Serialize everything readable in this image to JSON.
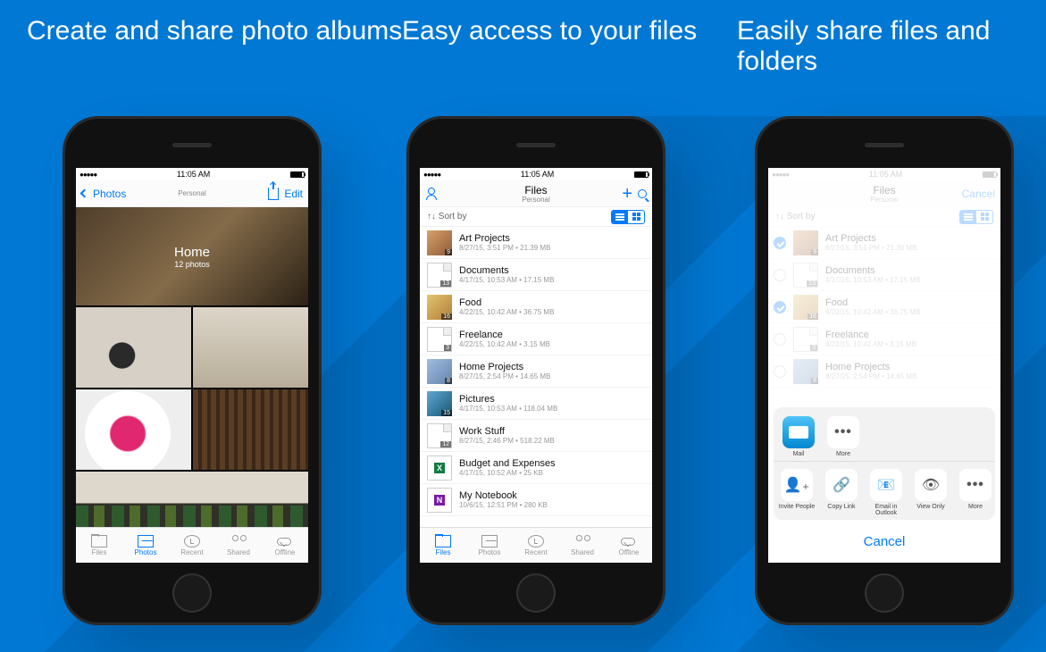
{
  "captions": {
    "c1": "Create and share photo albums",
    "c2": "Easy access to your files",
    "c3": "Easily share files and folders"
  },
  "status": {
    "time": "11:05 AM",
    "carrier_dots": "●●●●●",
    "wifi": "􀙇"
  },
  "screen1": {
    "back": "Photos",
    "title_sub": "Personal",
    "edit": "Edit",
    "album_title": "Home",
    "album_count": "12 photos"
  },
  "screen2": {
    "title": "Files",
    "title_sub": "Personal",
    "sort_label": "Sort by"
  },
  "screen3": {
    "title": "Files",
    "title_sub": "Personal",
    "cancel": "Cancel",
    "sort_label": "Sort by"
  },
  "files": [
    {
      "name": "Art Projects",
      "meta": "8/27/15, 3:51 PM • 21.39 MB",
      "badge": "9",
      "kind": "art",
      "selected": true
    },
    {
      "name": "Documents",
      "meta": "4/17/15, 10:53 AM • 17.15 MB",
      "badge": "13",
      "kind": "doc",
      "selected": false
    },
    {
      "name": "Food",
      "meta": "4/22/15, 10:42 AM • 36.75 MB",
      "badge": "16",
      "kind": "food",
      "selected": true
    },
    {
      "name": "Freelance",
      "meta": "4/22/15, 10:42 AM • 3.15 MB",
      "badge": "3",
      "kind": "doc",
      "selected": false
    },
    {
      "name": "Home Projects",
      "meta": "8/27/15, 2:54 PM • 14.65 MB",
      "badge": "8",
      "kind": "hp",
      "selected": false
    },
    {
      "name": "Pictures",
      "meta": "4/17/15, 10:53 AM • 118.04 MB",
      "badge": "15",
      "kind": "pic",
      "selected": false
    },
    {
      "name": "Work Stuff",
      "meta": "8/27/15, 2:46 PM • 518.22 MB",
      "badge": "12",
      "kind": "doc",
      "selected": false
    },
    {
      "name": "Budget and Expenses",
      "meta": "4/17/15, 10:52 AM • 25 KB",
      "badge": "",
      "kind": "excel",
      "selected": false
    },
    {
      "name": "My Notebook",
      "meta": "10/6/15, 12:51 PM • 280 KB",
      "badge": "",
      "kind": "onenote",
      "selected": false
    }
  ],
  "tabs": [
    {
      "id": "files",
      "label": "Files"
    },
    {
      "id": "photos",
      "label": "Photos"
    },
    {
      "id": "recent",
      "label": "Recent"
    },
    {
      "id": "shared",
      "label": "Shared"
    },
    {
      "id": "offline",
      "label": "Offline"
    }
  ],
  "share_sheet": {
    "row1": [
      {
        "label": "Mail",
        "icon": "mail"
      },
      {
        "label": "More",
        "icon": "more"
      }
    ],
    "row2": [
      {
        "label": "Invite People",
        "icon": "person-plus"
      },
      {
        "label": "Copy Link",
        "icon": "link"
      },
      {
        "label": "Email in Outlook",
        "icon": "outlook"
      },
      {
        "label": "View Only",
        "icon": "eye"
      },
      {
        "label": "More",
        "icon": "more"
      }
    ],
    "cancel": "Cancel"
  }
}
